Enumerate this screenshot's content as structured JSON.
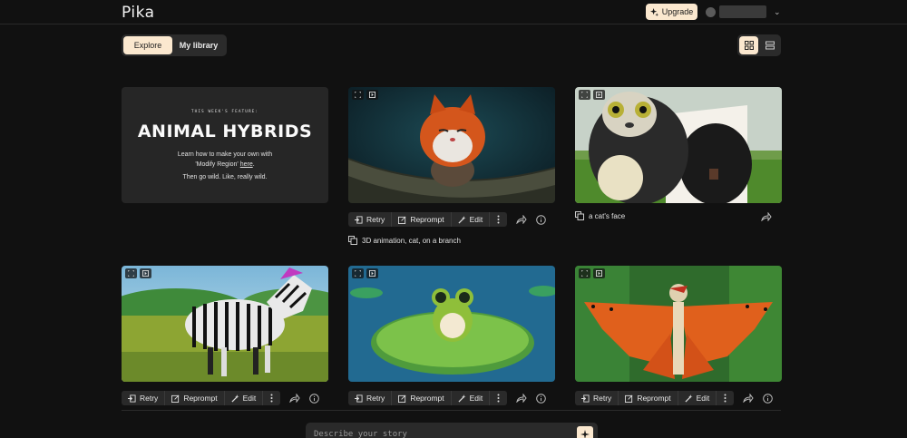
{
  "header": {
    "logo": "Pika",
    "upgrade_label": "Upgrade"
  },
  "tabs": {
    "explore": "Explore",
    "library": "My library"
  },
  "feature": {
    "kicker": "THIS WEEK'S FEATURE:",
    "title": "ANIMAL HYBRIDS",
    "line1": "Learn how to make your own with",
    "line2_pre": "'Modify Region' ",
    "line2_link": "here",
    "line2_post": ".",
    "line3": "Then go wild. Like, really wild."
  },
  "actions": {
    "retry": "Retry",
    "reprompt": "Reprompt",
    "edit": "Edit"
  },
  "captions": {
    "cat_branch": "3D animation, cat, on a branch",
    "cow_cat": "a cat's face"
  },
  "prompt": {
    "placeholder": "Describe your story"
  },
  "colors": {
    "accent": "#fbe8cf",
    "background": "#111111",
    "panel": "#2a2a2a"
  }
}
